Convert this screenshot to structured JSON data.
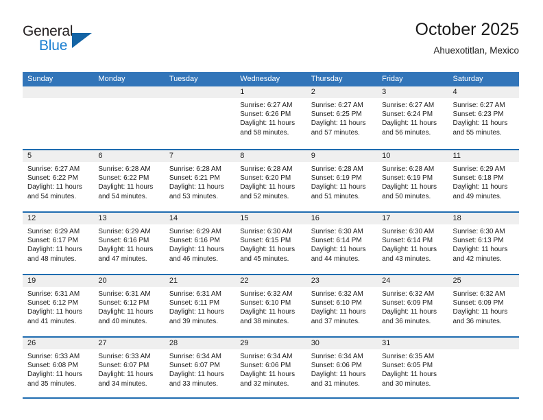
{
  "brand": {
    "name_top": "General",
    "name_bottom": "Blue",
    "accent_color": "#1b7fd1",
    "triangle_color": "#1464a5"
  },
  "header": {
    "title": "October 2025",
    "subtitle": "Ahuexotitlan, Mexico"
  },
  "theme": {
    "header_bg": "#3275b9",
    "row_divider": "#1f6cb0",
    "day_band_bg": "#efefef"
  },
  "weekdays": [
    "Sunday",
    "Monday",
    "Tuesday",
    "Wednesday",
    "Thursday",
    "Friday",
    "Saturday"
  ],
  "weeks": [
    [
      {
        "day": "",
        "empty": true
      },
      {
        "day": "",
        "empty": true
      },
      {
        "day": "",
        "empty": true
      },
      {
        "day": "1",
        "sunrise": "Sunrise: 6:27 AM",
        "sunset": "Sunset: 6:26 PM",
        "daylight": "Daylight: 11 hours and 58 minutes."
      },
      {
        "day": "2",
        "sunrise": "Sunrise: 6:27 AM",
        "sunset": "Sunset: 6:25 PM",
        "daylight": "Daylight: 11 hours and 57 minutes."
      },
      {
        "day": "3",
        "sunrise": "Sunrise: 6:27 AM",
        "sunset": "Sunset: 6:24 PM",
        "daylight": "Daylight: 11 hours and 56 minutes."
      },
      {
        "day": "4",
        "sunrise": "Sunrise: 6:27 AM",
        "sunset": "Sunset: 6:23 PM",
        "daylight": "Daylight: 11 hours and 55 minutes."
      }
    ],
    [
      {
        "day": "5",
        "sunrise": "Sunrise: 6:27 AM",
        "sunset": "Sunset: 6:22 PM",
        "daylight": "Daylight: 11 hours and 54 minutes."
      },
      {
        "day": "6",
        "sunrise": "Sunrise: 6:28 AM",
        "sunset": "Sunset: 6:22 PM",
        "daylight": "Daylight: 11 hours and 54 minutes."
      },
      {
        "day": "7",
        "sunrise": "Sunrise: 6:28 AM",
        "sunset": "Sunset: 6:21 PM",
        "daylight": "Daylight: 11 hours and 53 minutes."
      },
      {
        "day": "8",
        "sunrise": "Sunrise: 6:28 AM",
        "sunset": "Sunset: 6:20 PM",
        "daylight": "Daylight: 11 hours and 52 minutes."
      },
      {
        "day": "9",
        "sunrise": "Sunrise: 6:28 AM",
        "sunset": "Sunset: 6:19 PM",
        "daylight": "Daylight: 11 hours and 51 minutes."
      },
      {
        "day": "10",
        "sunrise": "Sunrise: 6:28 AM",
        "sunset": "Sunset: 6:19 PM",
        "daylight": "Daylight: 11 hours and 50 minutes."
      },
      {
        "day": "11",
        "sunrise": "Sunrise: 6:29 AM",
        "sunset": "Sunset: 6:18 PM",
        "daylight": "Daylight: 11 hours and 49 minutes."
      }
    ],
    [
      {
        "day": "12",
        "sunrise": "Sunrise: 6:29 AM",
        "sunset": "Sunset: 6:17 PM",
        "daylight": "Daylight: 11 hours and 48 minutes."
      },
      {
        "day": "13",
        "sunrise": "Sunrise: 6:29 AM",
        "sunset": "Sunset: 6:16 PM",
        "daylight": "Daylight: 11 hours and 47 minutes."
      },
      {
        "day": "14",
        "sunrise": "Sunrise: 6:29 AM",
        "sunset": "Sunset: 6:16 PM",
        "daylight": "Daylight: 11 hours and 46 minutes."
      },
      {
        "day": "15",
        "sunrise": "Sunrise: 6:30 AM",
        "sunset": "Sunset: 6:15 PM",
        "daylight": "Daylight: 11 hours and 45 minutes."
      },
      {
        "day": "16",
        "sunrise": "Sunrise: 6:30 AM",
        "sunset": "Sunset: 6:14 PM",
        "daylight": "Daylight: 11 hours and 44 minutes."
      },
      {
        "day": "17",
        "sunrise": "Sunrise: 6:30 AM",
        "sunset": "Sunset: 6:14 PM",
        "daylight": "Daylight: 11 hours and 43 minutes."
      },
      {
        "day": "18",
        "sunrise": "Sunrise: 6:30 AM",
        "sunset": "Sunset: 6:13 PM",
        "daylight": "Daylight: 11 hours and 42 minutes."
      }
    ],
    [
      {
        "day": "19",
        "sunrise": "Sunrise: 6:31 AM",
        "sunset": "Sunset: 6:12 PM",
        "daylight": "Daylight: 11 hours and 41 minutes."
      },
      {
        "day": "20",
        "sunrise": "Sunrise: 6:31 AM",
        "sunset": "Sunset: 6:12 PM",
        "daylight": "Daylight: 11 hours and 40 minutes."
      },
      {
        "day": "21",
        "sunrise": "Sunrise: 6:31 AM",
        "sunset": "Sunset: 6:11 PM",
        "daylight": "Daylight: 11 hours and 39 minutes."
      },
      {
        "day": "22",
        "sunrise": "Sunrise: 6:32 AM",
        "sunset": "Sunset: 6:10 PM",
        "daylight": "Daylight: 11 hours and 38 minutes."
      },
      {
        "day": "23",
        "sunrise": "Sunrise: 6:32 AM",
        "sunset": "Sunset: 6:10 PM",
        "daylight": "Daylight: 11 hours and 37 minutes."
      },
      {
        "day": "24",
        "sunrise": "Sunrise: 6:32 AM",
        "sunset": "Sunset: 6:09 PM",
        "daylight": "Daylight: 11 hours and 36 minutes."
      },
      {
        "day": "25",
        "sunrise": "Sunrise: 6:32 AM",
        "sunset": "Sunset: 6:09 PM",
        "daylight": "Daylight: 11 hours and 36 minutes."
      }
    ],
    [
      {
        "day": "26",
        "sunrise": "Sunrise: 6:33 AM",
        "sunset": "Sunset: 6:08 PM",
        "daylight": "Daylight: 11 hours and 35 minutes."
      },
      {
        "day": "27",
        "sunrise": "Sunrise: 6:33 AM",
        "sunset": "Sunset: 6:07 PM",
        "daylight": "Daylight: 11 hours and 34 minutes."
      },
      {
        "day": "28",
        "sunrise": "Sunrise: 6:34 AM",
        "sunset": "Sunset: 6:07 PM",
        "daylight": "Daylight: 11 hours and 33 minutes."
      },
      {
        "day": "29",
        "sunrise": "Sunrise: 6:34 AM",
        "sunset": "Sunset: 6:06 PM",
        "daylight": "Daylight: 11 hours and 32 minutes."
      },
      {
        "day": "30",
        "sunrise": "Sunrise: 6:34 AM",
        "sunset": "Sunset: 6:06 PM",
        "daylight": "Daylight: 11 hours and 31 minutes."
      },
      {
        "day": "31",
        "sunrise": "Sunrise: 6:35 AM",
        "sunset": "Sunset: 6:05 PM",
        "daylight": "Daylight: 11 hours and 30 minutes."
      },
      {
        "day": "",
        "empty": true
      }
    ]
  ]
}
